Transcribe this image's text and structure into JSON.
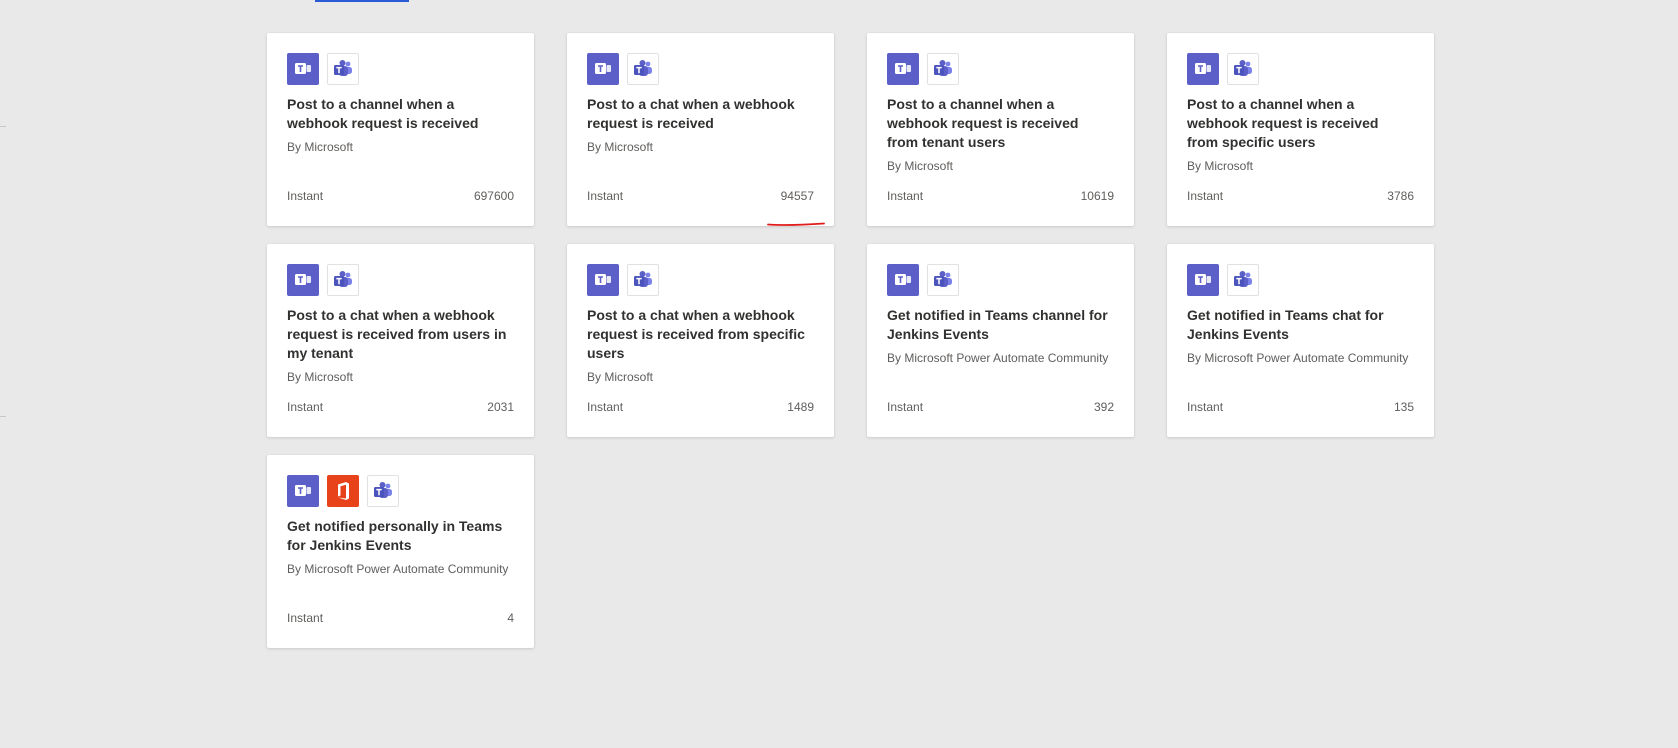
{
  "accent_color": "#5b5fc7",
  "office_color": "#e8421a",
  "cards": [
    {
      "title": "Post to a channel when a webhook request is received",
      "author": "By Microsoft",
      "type": "Instant",
      "count": "697600",
      "icons": [
        "teams-message-icon",
        "teams-icon"
      ]
    },
    {
      "title": "Post to a chat when a webhook request is received",
      "author": "By Microsoft",
      "type": "Instant",
      "count": "94557",
      "icons": [
        "teams-message-icon",
        "teams-icon"
      ]
    },
    {
      "title": "Post to a channel when a webhook request is received from tenant users",
      "author": "By Microsoft",
      "type": "Instant",
      "count": "10619",
      "icons": [
        "teams-message-icon",
        "teams-icon"
      ]
    },
    {
      "title": "Post to a channel when a webhook request is received from specific users",
      "author": "By Microsoft",
      "type": "Instant",
      "count": "3786",
      "icons": [
        "teams-message-icon",
        "teams-icon"
      ]
    },
    {
      "title": "Post to a chat when a webhook request is received from users in my tenant",
      "author": "By Microsoft",
      "type": "Instant",
      "count": "2031",
      "icons": [
        "teams-message-icon",
        "teams-icon"
      ]
    },
    {
      "title": "Post to a chat when a webhook request is received from specific users",
      "author": "By Microsoft",
      "type": "Instant",
      "count": "1489",
      "icons": [
        "teams-message-icon",
        "teams-icon"
      ]
    },
    {
      "title": "Get notified in Teams channel for Jenkins Events",
      "author": "By Microsoft Power Automate Community",
      "type": "Instant",
      "count": "392",
      "icons": [
        "teams-message-icon",
        "teams-icon"
      ]
    },
    {
      "title": "Get notified in Teams chat for Jenkins Events",
      "author": "By Microsoft Power Automate Community",
      "type": "Instant",
      "count": "135",
      "icons": [
        "teams-message-icon",
        "teams-icon"
      ]
    },
    {
      "title": "Get notified personally in Teams for Jenkins Events",
      "author": "By Microsoft Power Automate Community",
      "type": "Instant",
      "count": "4",
      "icons": [
        "teams-message-icon",
        "office-icon",
        "teams-icon"
      ]
    }
  ]
}
